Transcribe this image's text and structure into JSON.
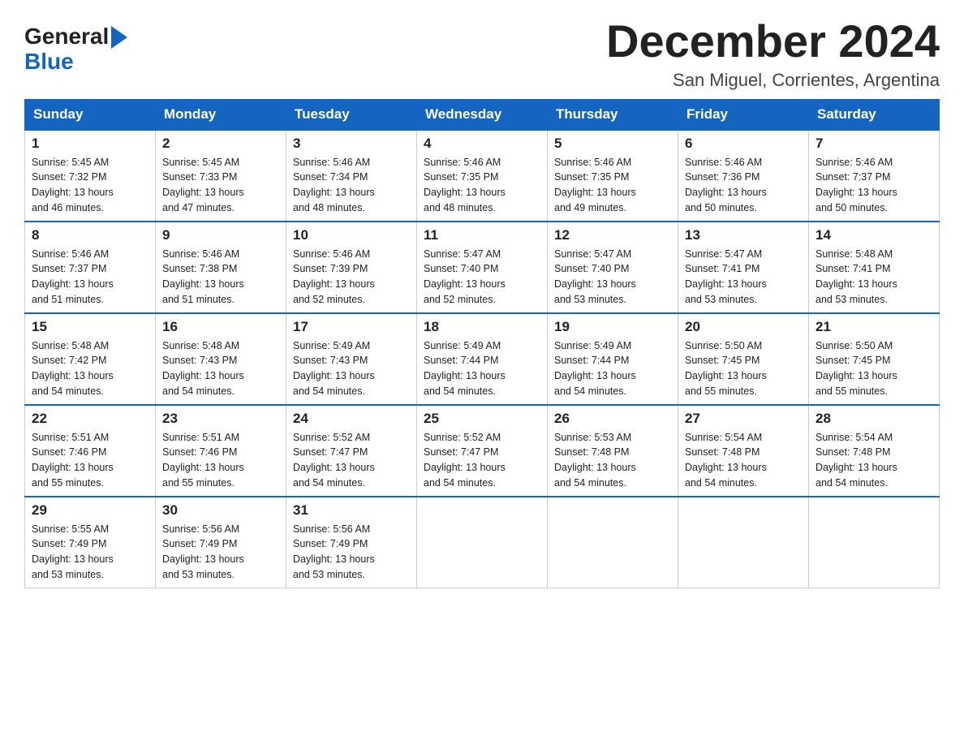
{
  "logo": {
    "line1_black": "General",
    "line1_blue_arrow": "▶",
    "line2": "Blue"
  },
  "title": {
    "month_year": "December 2024",
    "location": "San Miguel, Corrientes, Argentina"
  },
  "weekdays": [
    "Sunday",
    "Monday",
    "Tuesday",
    "Wednesday",
    "Thursday",
    "Friday",
    "Saturday"
  ],
  "weeks": [
    [
      {
        "day": "1",
        "sunrise": "5:45 AM",
        "sunset": "7:32 PM",
        "daylight": "13 hours and 46 minutes."
      },
      {
        "day": "2",
        "sunrise": "5:45 AM",
        "sunset": "7:33 PM",
        "daylight": "13 hours and 47 minutes."
      },
      {
        "day": "3",
        "sunrise": "5:46 AM",
        "sunset": "7:34 PM",
        "daylight": "13 hours and 48 minutes."
      },
      {
        "day": "4",
        "sunrise": "5:46 AM",
        "sunset": "7:35 PM",
        "daylight": "13 hours and 48 minutes."
      },
      {
        "day": "5",
        "sunrise": "5:46 AM",
        "sunset": "7:35 PM",
        "daylight": "13 hours and 49 minutes."
      },
      {
        "day": "6",
        "sunrise": "5:46 AM",
        "sunset": "7:36 PM",
        "daylight": "13 hours and 50 minutes."
      },
      {
        "day": "7",
        "sunrise": "5:46 AM",
        "sunset": "7:37 PM",
        "daylight": "13 hours and 50 minutes."
      }
    ],
    [
      {
        "day": "8",
        "sunrise": "5:46 AM",
        "sunset": "7:37 PM",
        "daylight": "13 hours and 51 minutes."
      },
      {
        "day": "9",
        "sunrise": "5:46 AM",
        "sunset": "7:38 PM",
        "daylight": "13 hours and 51 minutes."
      },
      {
        "day": "10",
        "sunrise": "5:46 AM",
        "sunset": "7:39 PM",
        "daylight": "13 hours and 52 minutes."
      },
      {
        "day": "11",
        "sunrise": "5:47 AM",
        "sunset": "7:40 PM",
        "daylight": "13 hours and 52 minutes."
      },
      {
        "day": "12",
        "sunrise": "5:47 AM",
        "sunset": "7:40 PM",
        "daylight": "13 hours and 53 minutes."
      },
      {
        "day": "13",
        "sunrise": "5:47 AM",
        "sunset": "7:41 PM",
        "daylight": "13 hours and 53 minutes."
      },
      {
        "day": "14",
        "sunrise": "5:48 AM",
        "sunset": "7:41 PM",
        "daylight": "13 hours and 53 minutes."
      }
    ],
    [
      {
        "day": "15",
        "sunrise": "5:48 AM",
        "sunset": "7:42 PM",
        "daylight": "13 hours and 54 minutes."
      },
      {
        "day": "16",
        "sunrise": "5:48 AM",
        "sunset": "7:43 PM",
        "daylight": "13 hours and 54 minutes."
      },
      {
        "day": "17",
        "sunrise": "5:49 AM",
        "sunset": "7:43 PM",
        "daylight": "13 hours and 54 minutes."
      },
      {
        "day": "18",
        "sunrise": "5:49 AM",
        "sunset": "7:44 PM",
        "daylight": "13 hours and 54 minutes."
      },
      {
        "day": "19",
        "sunrise": "5:49 AM",
        "sunset": "7:44 PM",
        "daylight": "13 hours and 54 minutes."
      },
      {
        "day": "20",
        "sunrise": "5:50 AM",
        "sunset": "7:45 PM",
        "daylight": "13 hours and 55 minutes."
      },
      {
        "day": "21",
        "sunrise": "5:50 AM",
        "sunset": "7:45 PM",
        "daylight": "13 hours and 55 minutes."
      }
    ],
    [
      {
        "day": "22",
        "sunrise": "5:51 AM",
        "sunset": "7:46 PM",
        "daylight": "13 hours and 55 minutes."
      },
      {
        "day": "23",
        "sunrise": "5:51 AM",
        "sunset": "7:46 PM",
        "daylight": "13 hours and 55 minutes."
      },
      {
        "day": "24",
        "sunrise": "5:52 AM",
        "sunset": "7:47 PM",
        "daylight": "13 hours and 54 minutes."
      },
      {
        "day": "25",
        "sunrise": "5:52 AM",
        "sunset": "7:47 PM",
        "daylight": "13 hours and 54 minutes."
      },
      {
        "day": "26",
        "sunrise": "5:53 AM",
        "sunset": "7:48 PM",
        "daylight": "13 hours and 54 minutes."
      },
      {
        "day": "27",
        "sunrise": "5:54 AM",
        "sunset": "7:48 PM",
        "daylight": "13 hours and 54 minutes."
      },
      {
        "day": "28",
        "sunrise": "5:54 AM",
        "sunset": "7:48 PM",
        "daylight": "13 hours and 54 minutes."
      }
    ],
    [
      {
        "day": "29",
        "sunrise": "5:55 AM",
        "sunset": "7:49 PM",
        "daylight": "13 hours and 53 minutes."
      },
      {
        "day": "30",
        "sunrise": "5:56 AM",
        "sunset": "7:49 PM",
        "daylight": "13 hours and 53 minutes."
      },
      {
        "day": "31",
        "sunrise": "5:56 AM",
        "sunset": "7:49 PM",
        "daylight": "13 hours and 53 minutes."
      },
      null,
      null,
      null,
      null
    ]
  ],
  "labels": {
    "sunrise": "Sunrise:",
    "sunset": "Sunset:",
    "daylight": "Daylight:"
  }
}
